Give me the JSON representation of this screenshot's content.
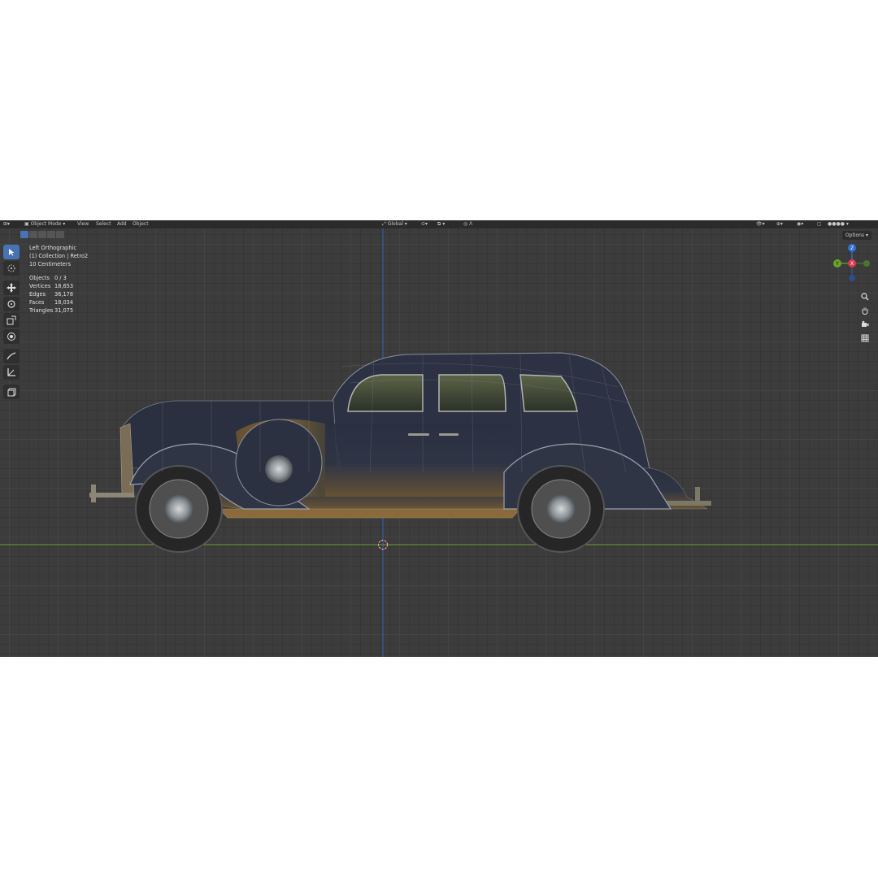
{
  "header": {
    "mode_label": "Object Mode",
    "menu_view": "View",
    "menu_select": "Select",
    "menu_add": "Add",
    "menu_object": "Object",
    "transform_orientation": "Global",
    "options_label": "Options"
  },
  "viewport_info": {
    "view_name": "Left Orthographic",
    "collection": "(1) Collection | Retro2",
    "grid_scale": "10 Centimeters"
  },
  "stats": [
    {
      "label": "Objects",
      "value": "0 / 3"
    },
    {
      "label": "Vertices",
      "value": "18,653"
    },
    {
      "label": "Edges",
      "value": "36,178"
    },
    {
      "label": "Faces",
      "value": "18,034"
    },
    {
      "label": "Triangles",
      "value": "31,075"
    }
  ],
  "gizmo": {
    "z": "Z",
    "y": "Y",
    "x": "X"
  },
  "colors": {
    "accent": "#4772b3",
    "axis_x": "#e0394f",
    "axis_y": "#6ba52a",
    "axis_z": "#2f6fd6"
  },
  "tools": [
    "select-box-icon",
    "cursor-icon",
    "move-icon",
    "rotate-icon",
    "scale-icon",
    "transform-icon",
    "annotate-icon",
    "measure-icon",
    "add-cube-icon"
  ]
}
